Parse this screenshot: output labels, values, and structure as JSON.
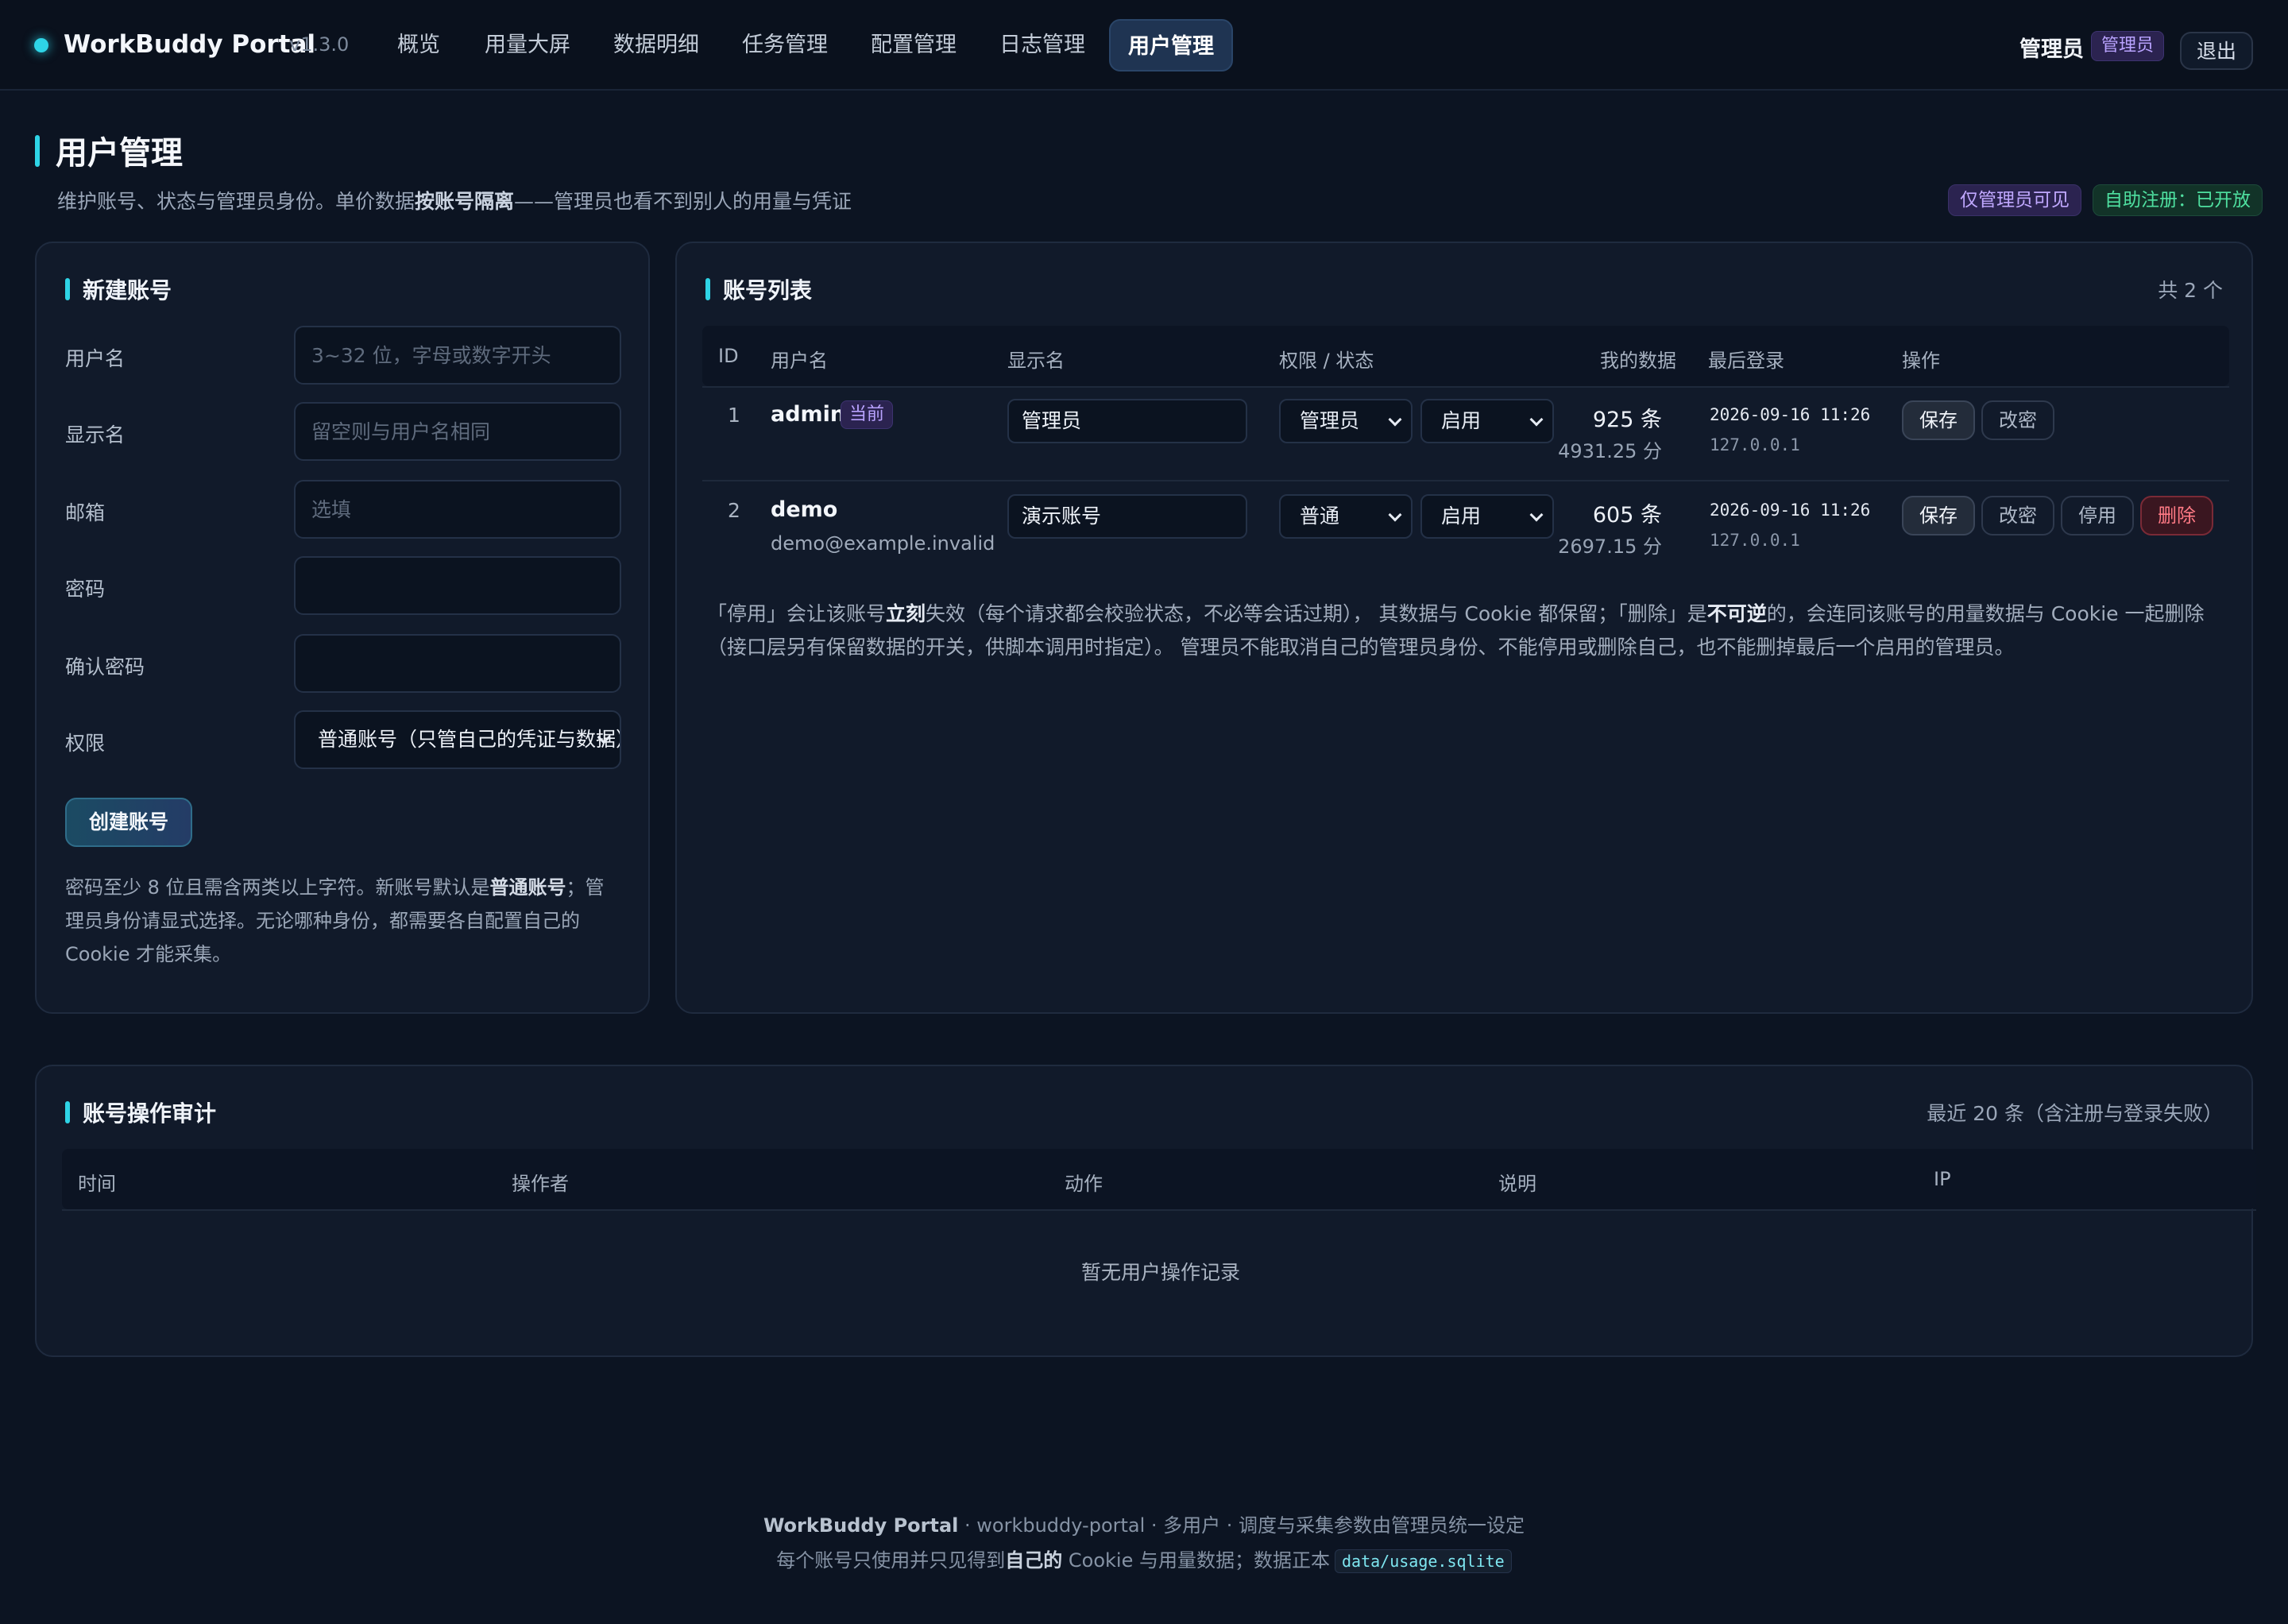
{
  "app": {
    "name": "WorkBuddy Portal",
    "version": "v1.3.0",
    "accent": "#2ed4e6"
  },
  "nav": {
    "tabs": [
      {
        "label": "概览"
      },
      {
        "label": "用量大屏"
      },
      {
        "label": "数据明细"
      },
      {
        "label": "任务管理"
      },
      {
        "label": "配置管理"
      },
      {
        "label": "日志管理"
      },
      {
        "label": "用户管理",
        "active": true
      }
    ]
  },
  "user": {
    "name": "管理员",
    "role_badge": "管理员",
    "logout_label": "退出"
  },
  "page": {
    "title": "用户管理",
    "subtitle_pre": "维护账号、状态与管理员身份。单价数据",
    "subtitle_bold": "按账号隔离",
    "subtitle_post": "——管理员也看不到别人的用量与凭证",
    "pill_admin_only": "仅管理员可见",
    "pill_self_register": "自助注册：已开放"
  },
  "new_account": {
    "title": "新建账号",
    "fields": {
      "username": {
        "label": "用户名",
        "placeholder": "3~32 位，字母或数字开头",
        "value": ""
      },
      "display_name": {
        "label": "显示名",
        "placeholder": "留空则与用户名相同",
        "value": ""
      },
      "email": {
        "label": "邮箱",
        "placeholder": "选填",
        "value": ""
      },
      "password": {
        "label": "密码",
        "value": ""
      },
      "confirm_password": {
        "label": "确认密码",
        "value": ""
      },
      "role": {
        "label": "权限",
        "value": "普通账号（只管自己的凭证与数据）"
      }
    },
    "create_label": "创建账号",
    "note_1": "密码至少 8 位且需含两类以上字符。新账号默认是",
    "note_bold": "普通账号",
    "note_2": "；管理员身份请显式选择。无论哪种身份，都需要各自配置自己的 Cookie 才能采集。"
  },
  "accounts": {
    "title": "账号列表",
    "count_label": "共 2 个",
    "columns": {
      "id": "ID",
      "username": "用户名",
      "display": "显示名",
      "role_status": "权限 / 状态",
      "my_data": "我的数据",
      "last_login": "最后登录",
      "actions": "操作"
    },
    "rows": [
      {
        "id": "1",
        "username": "admin",
        "current_badge": "当前",
        "email": "",
        "display_name": "管理员",
        "role": "管理员",
        "status": "启用",
        "records": "925 条",
        "amount": "4931.25 分",
        "last_login_time": "2026-09-16 11:26",
        "last_login_ip": "127.0.0.1",
        "actions": {
          "save": "保存",
          "change_pwd": "改密"
        }
      },
      {
        "id": "2",
        "username": "demo",
        "current_badge": "",
        "email": "demo@example.invalid",
        "display_name": "演示账号",
        "role": "普通",
        "status": "启用",
        "records": "605 条",
        "amount": "2697.15 分",
        "last_login_time": "2026-09-16 11:26",
        "last_login_ip": "127.0.0.1",
        "actions": {
          "save": "保存",
          "change_pwd": "改密",
          "disable": "停用",
          "delete": "删除"
        }
      }
    ],
    "note": {
      "p1": "「停用」会让该账号",
      "b1": "立刻",
      "p2": "失效（每个请求都会校验状态，不必等会话过期）， 其数据与 Cookie 都保留；「删除」是",
      "b2": "不可逆",
      "p3": "的，会连同该账号的用量数据与 Cookie 一起删除（接口层另有保留数据的开关，供脚本调用时指定）。 管理员不能取消自己的管理员身份、不能停用或删除自己，也不能删掉最后一个启用的管理员。"
    }
  },
  "audit": {
    "title": "账号操作审计",
    "subtitle": "最近 20 条（含注册与登录失败）",
    "columns": {
      "time": "时间",
      "operator": "操作者",
      "action": "动作",
      "desc": "说明",
      "ip": "IP"
    },
    "empty": "暂无用户操作记录"
  },
  "footer": {
    "brand": "WorkBuddy Portal",
    "line1_rest": " · workbuddy-portal · 多用户 · 调度与采集参数由管理员统一设定",
    "line2_pre": "每个账号只使用并只见得到",
    "line2_bold": "自己的",
    "line2_post": " Cookie 与用量数据；数据正本",
    "db_path": "data/usage.sqlite"
  }
}
